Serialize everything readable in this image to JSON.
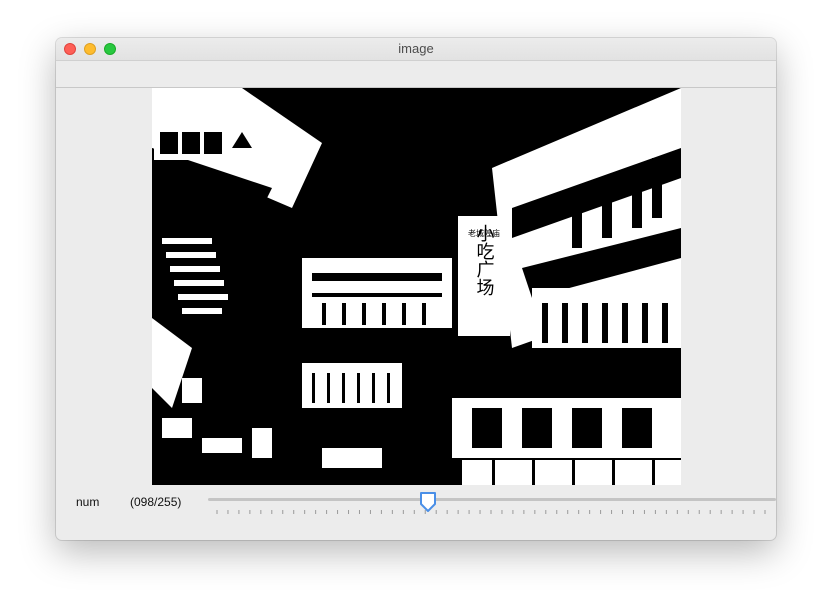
{
  "window": {
    "title": "image",
    "buttons": {
      "close_color": "#fe5f57",
      "minimize_color": "#febc2e",
      "zoom_color": "#28c840"
    }
  },
  "image": {
    "description_icon": "binarized-photo",
    "signboard_text": "小吃广场",
    "signboard_small_text": "老城隍庙"
  },
  "trackbar": {
    "label": "num",
    "value_text": "(098/255)",
    "value": 98,
    "max": 255,
    "accent_color": "#4a8fe7"
  }
}
